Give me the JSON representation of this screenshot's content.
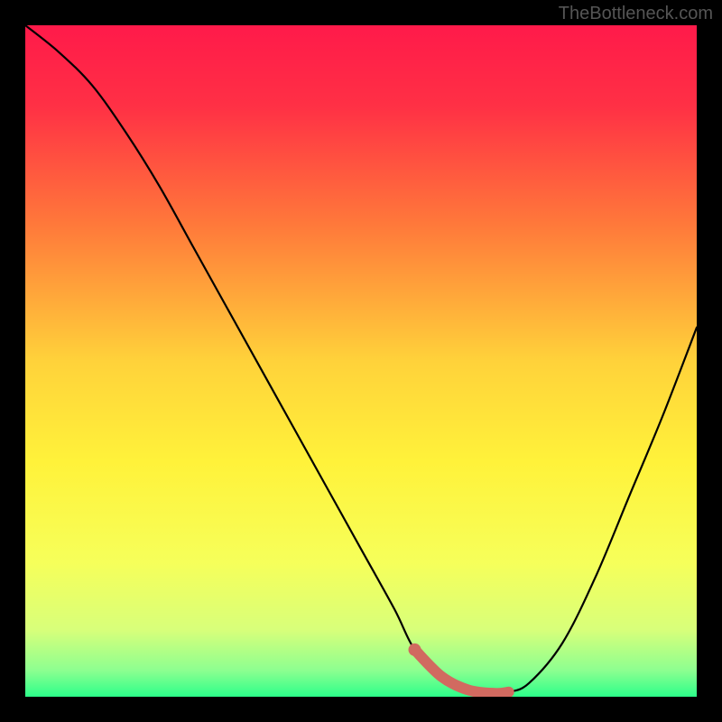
{
  "watermark": "TheBottleneck.com",
  "colors": {
    "frame": "#000000",
    "watermark": "#555555",
    "curve": "#000000",
    "marker": "#d16a60",
    "gradient_stops": [
      {
        "offset": 0.0,
        "color": "#ff1a4a"
      },
      {
        "offset": 0.12,
        "color": "#ff3045"
      },
      {
        "offset": 0.3,
        "color": "#ff7a3a"
      },
      {
        "offset": 0.5,
        "color": "#ffd23a"
      },
      {
        "offset": 0.65,
        "color": "#fff23a"
      },
      {
        "offset": 0.8,
        "color": "#f6ff5a"
      },
      {
        "offset": 0.9,
        "color": "#d8ff7a"
      },
      {
        "offset": 0.96,
        "color": "#8eff90"
      },
      {
        "offset": 1.0,
        "color": "#2cff8a"
      }
    ]
  },
  "chart_data": {
    "type": "line",
    "title": "",
    "xlabel": "",
    "ylabel": "",
    "xlim": [
      0,
      100
    ],
    "ylim": [
      0,
      100
    ],
    "series": [
      {
        "name": "bottleneck-curve",
        "x": [
          0,
          5,
          10,
          15,
          20,
          25,
          30,
          35,
          40,
          45,
          50,
          55,
          58,
          62,
          66,
          70,
          72,
          75,
          80,
          85,
          90,
          95,
          100
        ],
        "y": [
          100,
          96,
          91,
          84,
          76,
          67,
          58,
          49,
          40,
          31,
          22,
          13,
          7,
          3,
          1,
          0.5,
          0.7,
          2,
          8,
          18,
          30,
          42,
          55
        ]
      }
    ],
    "markers": {
      "name": "bottom-highlight",
      "x": [
        58,
        62,
        66,
        70,
        72
      ],
      "y": [
        7,
        3,
        1,
        0.5,
        0.7
      ]
    }
  }
}
